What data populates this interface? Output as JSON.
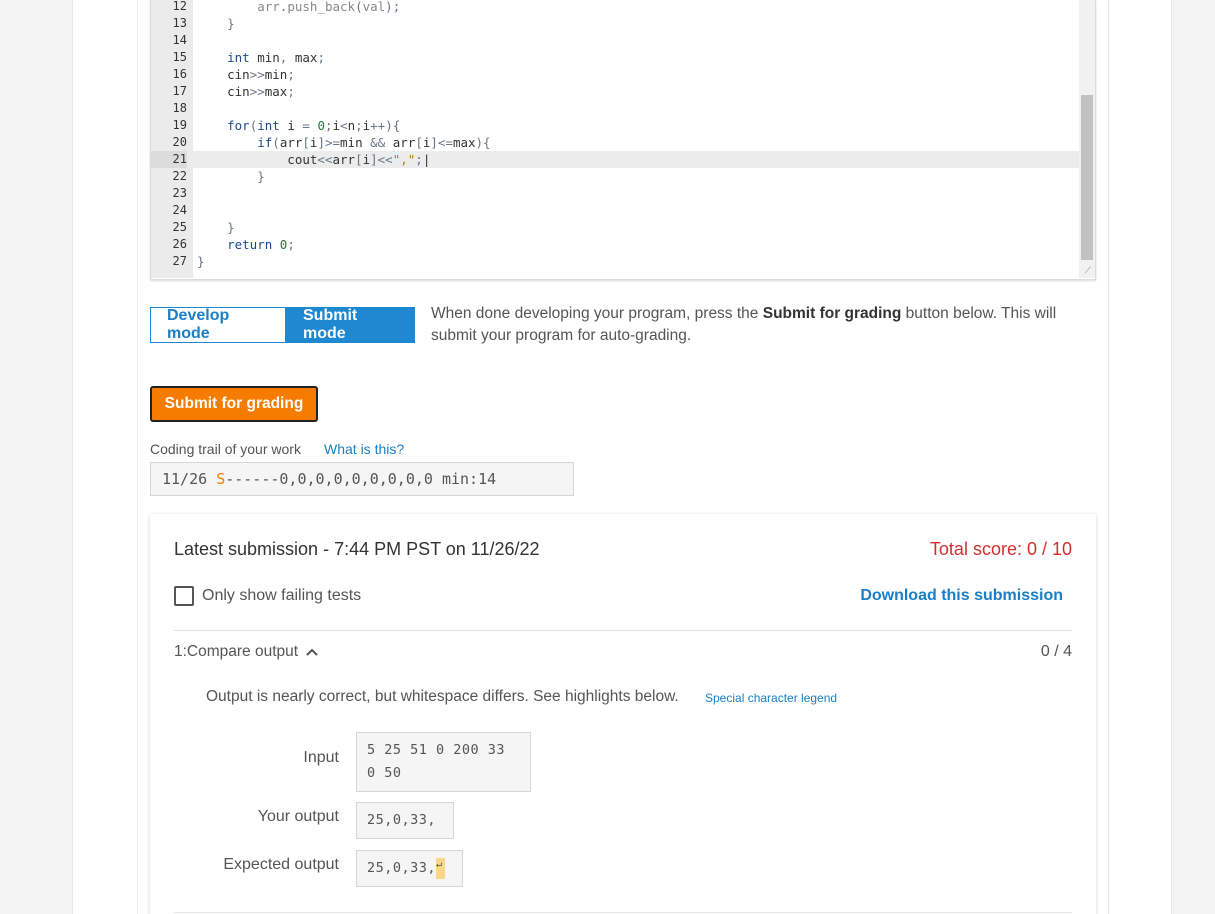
{
  "editor": {
    "lines": [
      {
        "num": "12",
        "html": "        <span class='gray'>arr</span><span class='op'>.</span><span class='gray'>push_back</span><span class='op'>(</span><span class='gray'>val</span><span class='op'>);</span>"
      },
      {
        "num": "13",
        "html": "    <span class='op'>}</span>"
      },
      {
        "num": "14",
        "html": ""
      },
      {
        "num": "15",
        "html": "    <span class='kw'>int</span> min<span class='op'>,</span> max<span class='op'>;</span>"
      },
      {
        "num": "16",
        "html": "    cin<span class='op'>&gt;&gt;</span>min<span class='op'>;</span>"
      },
      {
        "num": "17",
        "html": "    cin<span class='op'>&gt;&gt;</span>max<span class='op'>;</span>"
      },
      {
        "num": "18",
        "html": ""
      },
      {
        "num": "19",
        "html": "    <span class='kw'>for</span><span class='op'>(</span><span class='kw'>int</span> i <span class='op'>=</span> <span class='nm'>0</span><span class='op'>;</span>i<span class='op'>&lt;</span>n<span class='op'>;</span>i<span class='op'>++){</span>"
      },
      {
        "num": "20",
        "html": "        <span class='kw'>if</span><span class='op'>(</span>arr<span class='op'>[</span>i<span class='op'>]&gt;=</span>min <span class='op'>&amp;&amp;</span> arr<span class='op'>[</span>i<span class='op'>]&lt;=</span>max<span class='op'>){</span>"
      },
      {
        "num": "21",
        "html": "            cout<span class='op'>&lt;&lt;</span>arr<span class='op'>[</span>i<span class='op'>]&lt;&lt;</span><span class='str'>\",\"</span><span class='op'>;</span>|",
        "active": true
      },
      {
        "num": "22",
        "html": "        <span class='op'>}</span>"
      },
      {
        "num": "23",
        "html": ""
      },
      {
        "num": "24",
        "html": ""
      },
      {
        "num": "25",
        "html": "    <span class='op'>}</span>"
      },
      {
        "num": "26",
        "html": "    <span class='kw'>return</span> <span class='nm'>0</span><span class='op'>;</span>"
      },
      {
        "num": "27",
        "html": "<span class='op'>}</span>"
      }
    ]
  },
  "mode": {
    "develop_label": "Develop mode",
    "submit_label": "Submit mode",
    "desc_before": "When done developing your program, press the ",
    "desc_bold": "Submit for grading",
    "desc_after": " button below. This will submit your program for auto-grading."
  },
  "grade_button": "Submit for grading",
  "trail": {
    "label": "Coding trail of your work",
    "help": "What is this?",
    "date": "11/26 ",
    "s": "S",
    "rest": "------0,0,0,0,0,0,0,0,0 min:14"
  },
  "results": {
    "latest": "Latest submission - 7:44 PM PST on 11/26/22",
    "total": "Total score: 0 / 10",
    "only_failing": "Only show failing tests",
    "download": "Download this submission",
    "test_name": "1:Compare output",
    "test_score": "0 / 4",
    "message": "Output is nearly correct, but whitespace differs. See highlights below.",
    "legend": "Special character legend",
    "input_label": "Input",
    "input_value": "5 25 51 0 200 33\n0 50",
    "your_label": "Your output",
    "your_value": "25,0,33,",
    "expected_label": "Expected output",
    "expected_value": "25,0,33,",
    "newline_glyph": "↵"
  }
}
